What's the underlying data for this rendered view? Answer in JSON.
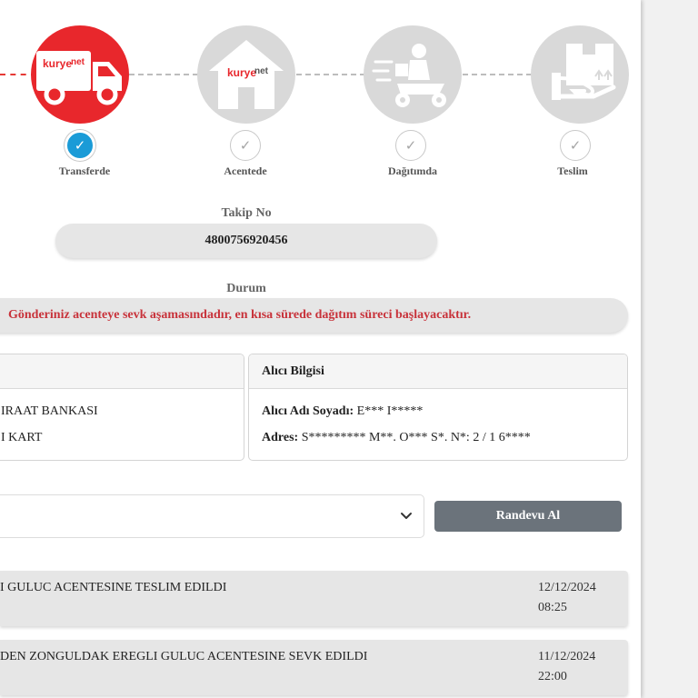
{
  "steps": [
    {
      "label": "Transferde",
      "state": "done",
      "icon": "delivery-truck-icon"
    },
    {
      "label": "Acentede",
      "state": "todo",
      "icon": "agency-house-icon"
    },
    {
      "label": "Dağıtımda",
      "state": "todo",
      "icon": "scooter-courier-icon"
    },
    {
      "label": "Teslim",
      "state": "todo",
      "icon": "package-hand-icon"
    }
  ],
  "brand": {
    "logo_text_a": "kurye",
    "logo_text_b": "net"
  },
  "check_glyph": "✓",
  "tracking": {
    "label": "Takip No",
    "number": "4800756920456"
  },
  "status": {
    "label": "Durum",
    "message": "Gönderiniz acenteye sevk aşamasındadır, en kısa sürede dağıtım süreci başlayacaktır."
  },
  "sender_card": {
    "line1": "IRAAT BANKASI",
    "line2": "I KART"
  },
  "receiver_card": {
    "title": "Alıcı Bilgisi",
    "name_label": "Alıcı Adı Soyadı:",
    "name_value": "E*** I*****",
    "address_label": "Adres:",
    "address_value": "S********* M**. O*** S*. N*: 2 / 1 6****"
  },
  "appointment": {
    "select_value": "",
    "button_label": "Randevu Al"
  },
  "events": [
    {
      "text": "I GULUC ACENTESINE TESLIM EDILDI",
      "date": "12/12/2024",
      "time": "08:25"
    },
    {
      "text": "DEN ZONGULDAK EREGLI GULUC ACENTESINE SEVK EDILDI",
      "date": "11/12/2024",
      "time": "22:00"
    }
  ],
  "colors": {
    "accent_red": "#e8272c",
    "check_blue": "#1a9bd7",
    "button_grey": "#6b737b",
    "status_red": "#c8323a"
  }
}
